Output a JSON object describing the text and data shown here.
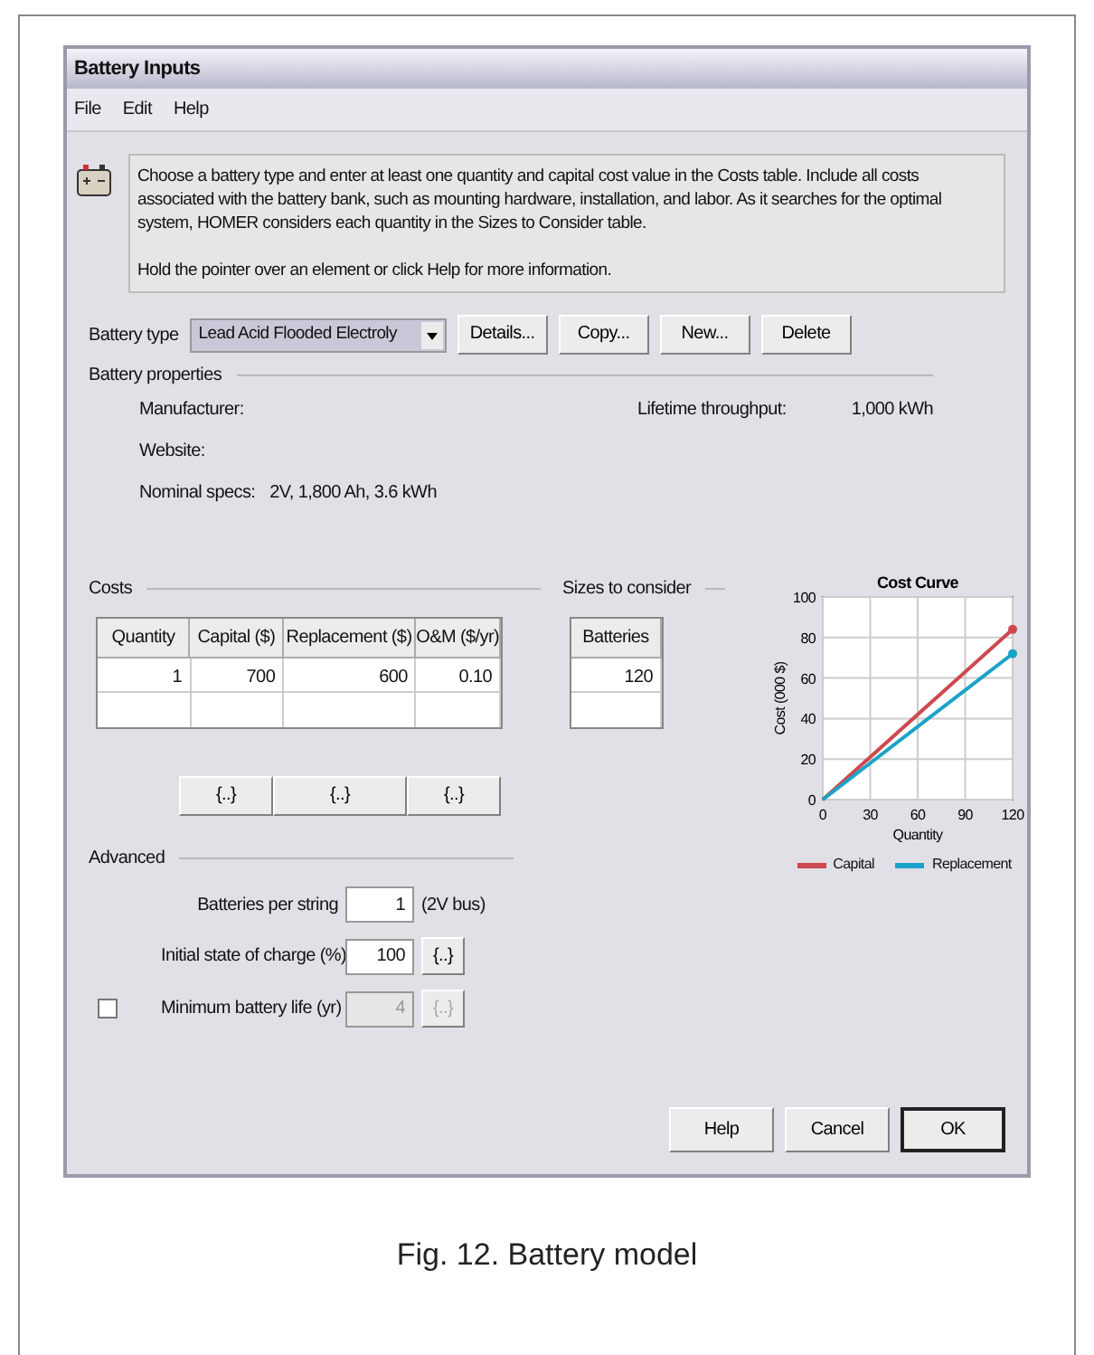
{
  "window": {
    "title": "Battery Inputs"
  },
  "menu": [
    "File",
    "Edit",
    "Help"
  ],
  "info": [
    "Choose a battery type and enter at least one quantity and capital cost value in the Costs table. Include all costs associated with the battery bank, such as mounting hardware, installation, and labor. As it searches for the optimal system, HOMER considers each quantity in the Sizes to Consider table.",
    "Hold the pointer over an element or click Help for more information."
  ],
  "battery_type": {
    "label": "Battery type",
    "value": "Lead Acid Flooded Electroly"
  },
  "type_buttons": [
    "Details...",
    "Copy...",
    "New...",
    "Delete"
  ],
  "properties": {
    "title": "Battery properties",
    "fields": [
      {
        "label": "Manufacturer:"
      },
      {
        "label": "Website:"
      },
      {
        "label": "Nominal specs:",
        "value": "2V, 1,800 Ah, 3.6 kWh"
      }
    ],
    "lifetime": {
      "label": "Lifetime throughput:",
      "value": "1,000 kWh"
    }
  },
  "costs": {
    "title": "Costs",
    "columns": [
      "Quantity",
      "Capital ($)",
      "Replacement ($)",
      "O&M ($/yr)"
    ],
    "rows": [
      [
        "1",
        "700",
        "600",
        "0.10"
      ]
    ],
    "buttons": [
      "{..}",
      "{..}",
      "{..}"
    ]
  },
  "sizes": {
    "title": "Sizes to consider",
    "columns": [
      "Batteries"
    ],
    "rows": [
      [
        "120"
      ]
    ]
  },
  "cost_curve": {
    "chart_data": {
      "type": "line",
      "title": "Cost Curve",
      "xlabel": "Quantity",
      "ylabel": "Cost (000 $)",
      "x": [
        0,
        120
      ],
      "series": [
        {
          "name": "Capital",
          "color": "#cc4a4f",
          "values": [
            0,
            84
          ]
        },
        {
          "name": "Replacement",
          "color": "#1aa3c8",
          "values": [
            0,
            72
          ]
        }
      ],
      "xlim": [
        0,
        120
      ],
      "ylim": [
        0,
        100
      ],
      "grid": true,
      "legend": true,
      "xticks": [
        {
          "value": 0,
          "label": "0"
        },
        {
          "value": 30,
          "label": "30"
        },
        {
          "value": 60,
          "label": "60"
        },
        {
          "value": 90,
          "label": "90"
        },
        {
          "value": 120,
          "label": "120"
        }
      ],
      "yticks": [
        {
          "value": 0,
          "label": "0"
        },
        {
          "value": 20,
          "label": "20"
        },
        {
          "value": 40,
          "label": "40"
        },
        {
          "value": 60,
          "label": "60"
        },
        {
          "value": 80,
          "label": "80"
        },
        {
          "value": 100,
          "label": "100"
        }
      ]
    }
  },
  "advanced": {
    "title": "Advanced",
    "fields": [
      {
        "kind": "field",
        "label": "Batteries per string",
        "value": "1",
        "unit": "(2V bus)"
      },
      {
        "kind": "field",
        "label": "Initial state of charge (%)",
        "value": "100",
        "button": "{..}"
      },
      {
        "kind": "checkbox_field",
        "label": "Minimum battery life (yr)",
        "checked": false,
        "value": "4",
        "button": "{..}"
      }
    ]
  },
  "dialog_buttons": [
    {
      "label": "Help",
      "default": false
    },
    {
      "label": "Cancel",
      "default": false
    },
    {
      "label": "OK",
      "default": true
    }
  ],
  "caption": "Fig. 12. Battery model"
}
